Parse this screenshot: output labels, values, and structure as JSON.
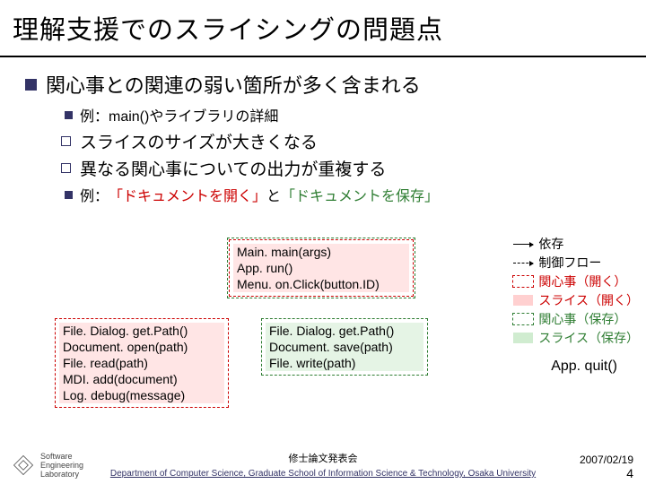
{
  "title": "理解支援でのスライシングの問題点",
  "b1": "関心事との関連の弱い箇所が多く含まれる",
  "b2a": "例：main()やライブラリの詳細",
  "b3a": "スライスのサイズが大きくなる",
  "b3b": "異なる関心事についての出力が重複する",
  "b2b_pre": "例：",
  "b2b_red": "「ドキュメントを開く」",
  "b2b_mid": "と",
  "b2b_grn": "「ドキュメントを保存」",
  "main1": "Main. main(args)",
  "main2": "App. run()",
  "main3": "Menu. on.Click(button.ID)",
  "left1": "File. Dialog. get.Path()",
  "left2": "Document. open(path)",
  "left3": "File. read(path)",
  "left4": "MDI. add(document)",
  "left5": "Log. debug(message)",
  "right1": "File. Dialog. get.Path()",
  "right2": "Document. save(path)",
  "right3": "File. write(path)",
  "lg1": "依存",
  "lg2": "制御フロー",
  "lg3": "関心事（開く）",
  "lg4": "スライス（開く）",
  "lg5": "関心事（保存）",
  "lg6": "スライス（保存）",
  "appquit": "App. quit()",
  "mid": "修士論文発表会",
  "date": "2007/02/19",
  "page": "4",
  "dept": "Department of Computer Science, Graduate School of Information Science & Technology, Osaka University",
  "logo1": "Software",
  "logo2": "Engineering",
  "logo3": "Laboratory"
}
